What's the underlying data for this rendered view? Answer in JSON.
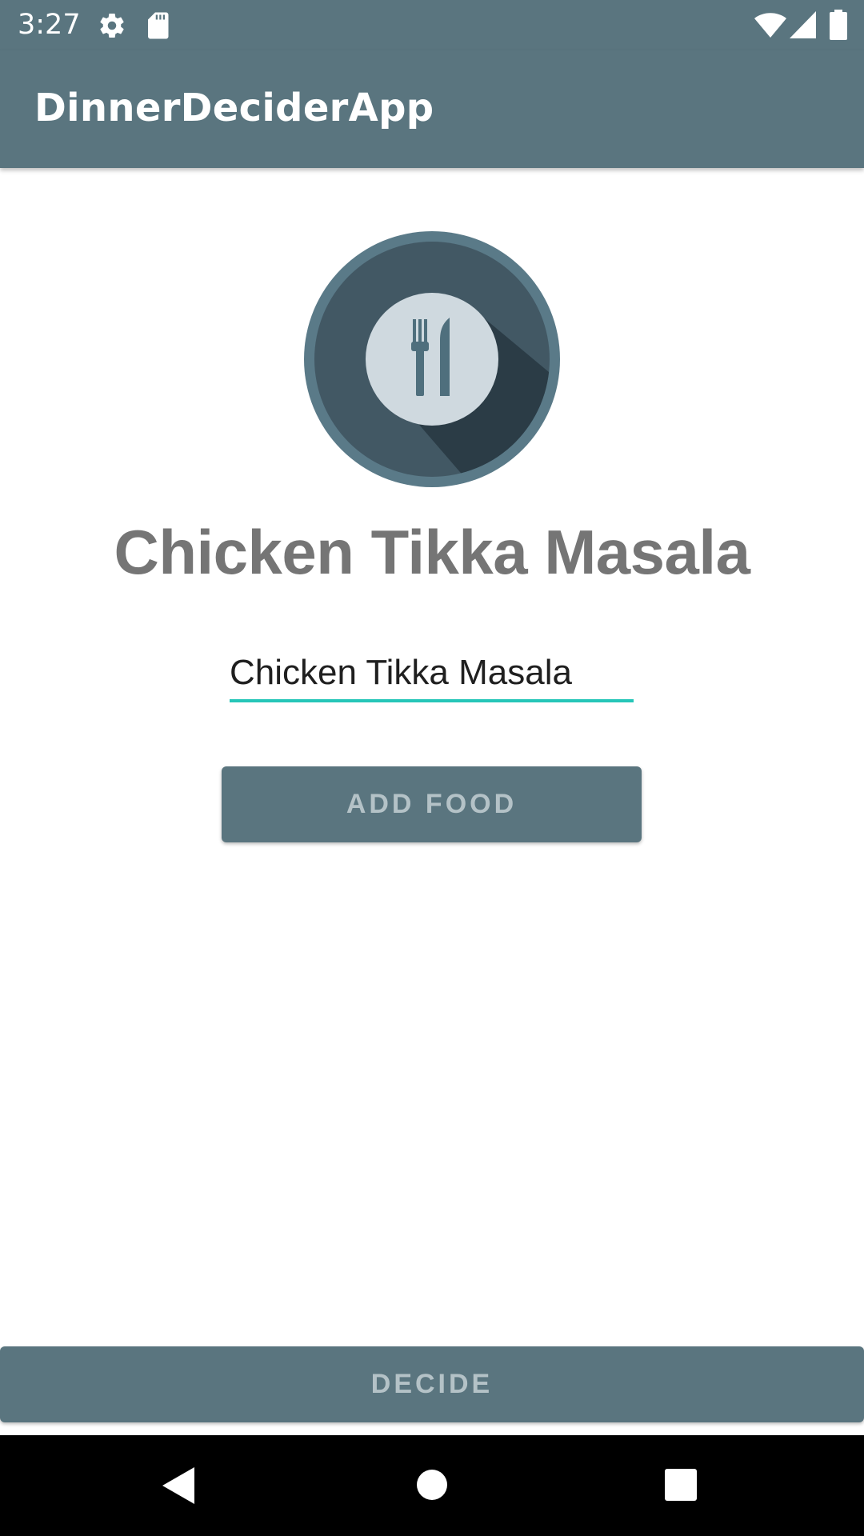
{
  "status_bar": {
    "time": "3:27",
    "icons": [
      "settings-icon",
      "sd-card-icon",
      "wifi-icon",
      "cell-signal-icon",
      "battery-icon"
    ]
  },
  "app_bar": {
    "title": "DinnerDeciderApp"
  },
  "main": {
    "logo_icon": "plate-fork-knife-icon",
    "selected_food": "Chicken Tikka Masala",
    "food_input": {
      "value": "Chicken Tikka Masala",
      "placeholder": ""
    },
    "add_button_label": "Add Food",
    "decide_button_label": "Decide"
  },
  "nav_bar": {
    "icons": [
      "back-icon",
      "home-icon",
      "recents-icon"
    ]
  },
  "colors": {
    "primary": "#5a757f",
    "accent": "#26c6b8",
    "button_text": "#b4c2c7",
    "heading_text": "#757575"
  }
}
